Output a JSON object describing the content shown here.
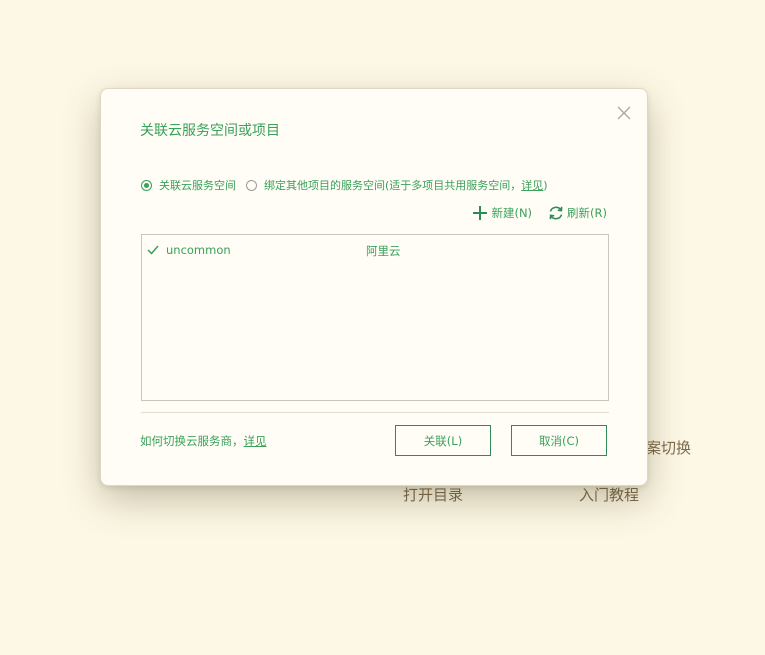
{
  "background": {
    "links": [
      {
        "label": "案切换"
      },
      {
        "label": "打开目录"
      },
      {
        "label": "入门教程"
      }
    ]
  },
  "dialog": {
    "title": "关联云服务空间或项目",
    "close_icon": "close-icon",
    "options": {
      "option1_label": "关联云服务空间",
      "option1_checked": true,
      "option2_label": "绑定其他项目的服务空间",
      "option2_note_prefix": " (适于多项目共用服务空间，",
      "option2_note_link": "详见",
      "option2_note_suffix": ")",
      "option2_checked": false
    },
    "toolbar": {
      "new_icon": "plus-icon",
      "new_label": "新建(N)",
      "refresh_icon": "refresh-icon",
      "refresh_label": "刷新(R)"
    },
    "spaces": [
      {
        "name": "uncommon",
        "provider": "阿里云",
        "selected": true
      }
    ],
    "footer": {
      "help_text": "如何切换云服务商，",
      "help_link": "详见",
      "ok_label": "关联(L)",
      "cancel_label": "取消(C)"
    }
  },
  "colors": {
    "accent": "#3aa05a",
    "button_border": "#2e8b57",
    "background": "#fdf8e6",
    "dialog_background": "#fffdf6"
  }
}
